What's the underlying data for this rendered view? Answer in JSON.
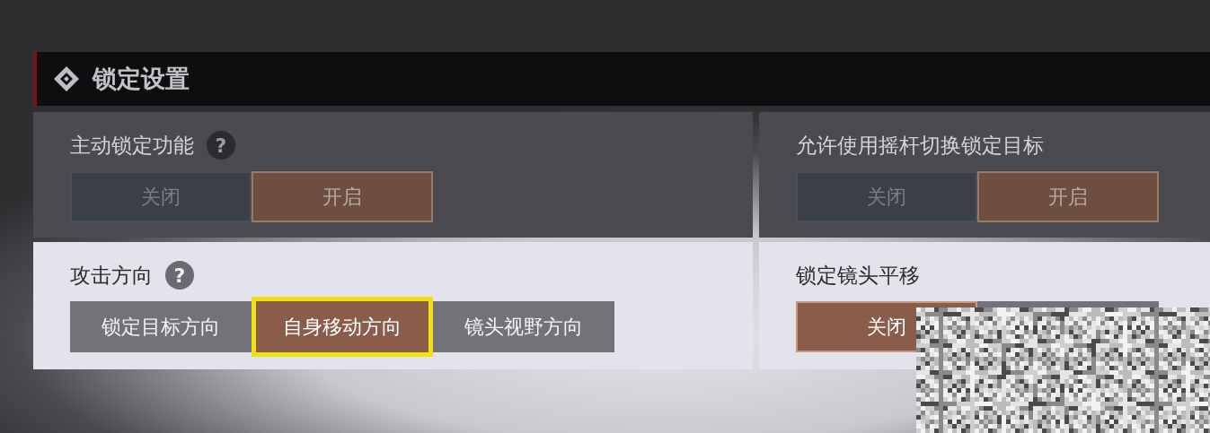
{
  "section": {
    "title": "锁定设置"
  },
  "settings": [
    {
      "label": "主动锁定功能",
      "hint": "?",
      "options": [
        {
          "label": "关闭",
          "selected": false
        },
        {
          "label": "开启",
          "selected": true
        }
      ]
    },
    {
      "label": "允许使用摇杆切换锁定目标",
      "options": [
        {
          "label": "关闭",
          "selected": false
        },
        {
          "label": "开启",
          "selected": true
        }
      ]
    },
    {
      "label": "攻击方向",
      "hint": "?",
      "options": [
        {
          "label": "锁定目标方向",
          "selected": false
        },
        {
          "label": "自身移动方向",
          "selected": true,
          "highlighted": true
        },
        {
          "label": "镜头视野方向",
          "selected": false
        }
      ]
    },
    {
      "label": "锁定镜头平移",
      "options": [
        {
          "label": "关闭",
          "selected": true
        },
        {
          "selected": false
        }
      ]
    }
  ]
}
